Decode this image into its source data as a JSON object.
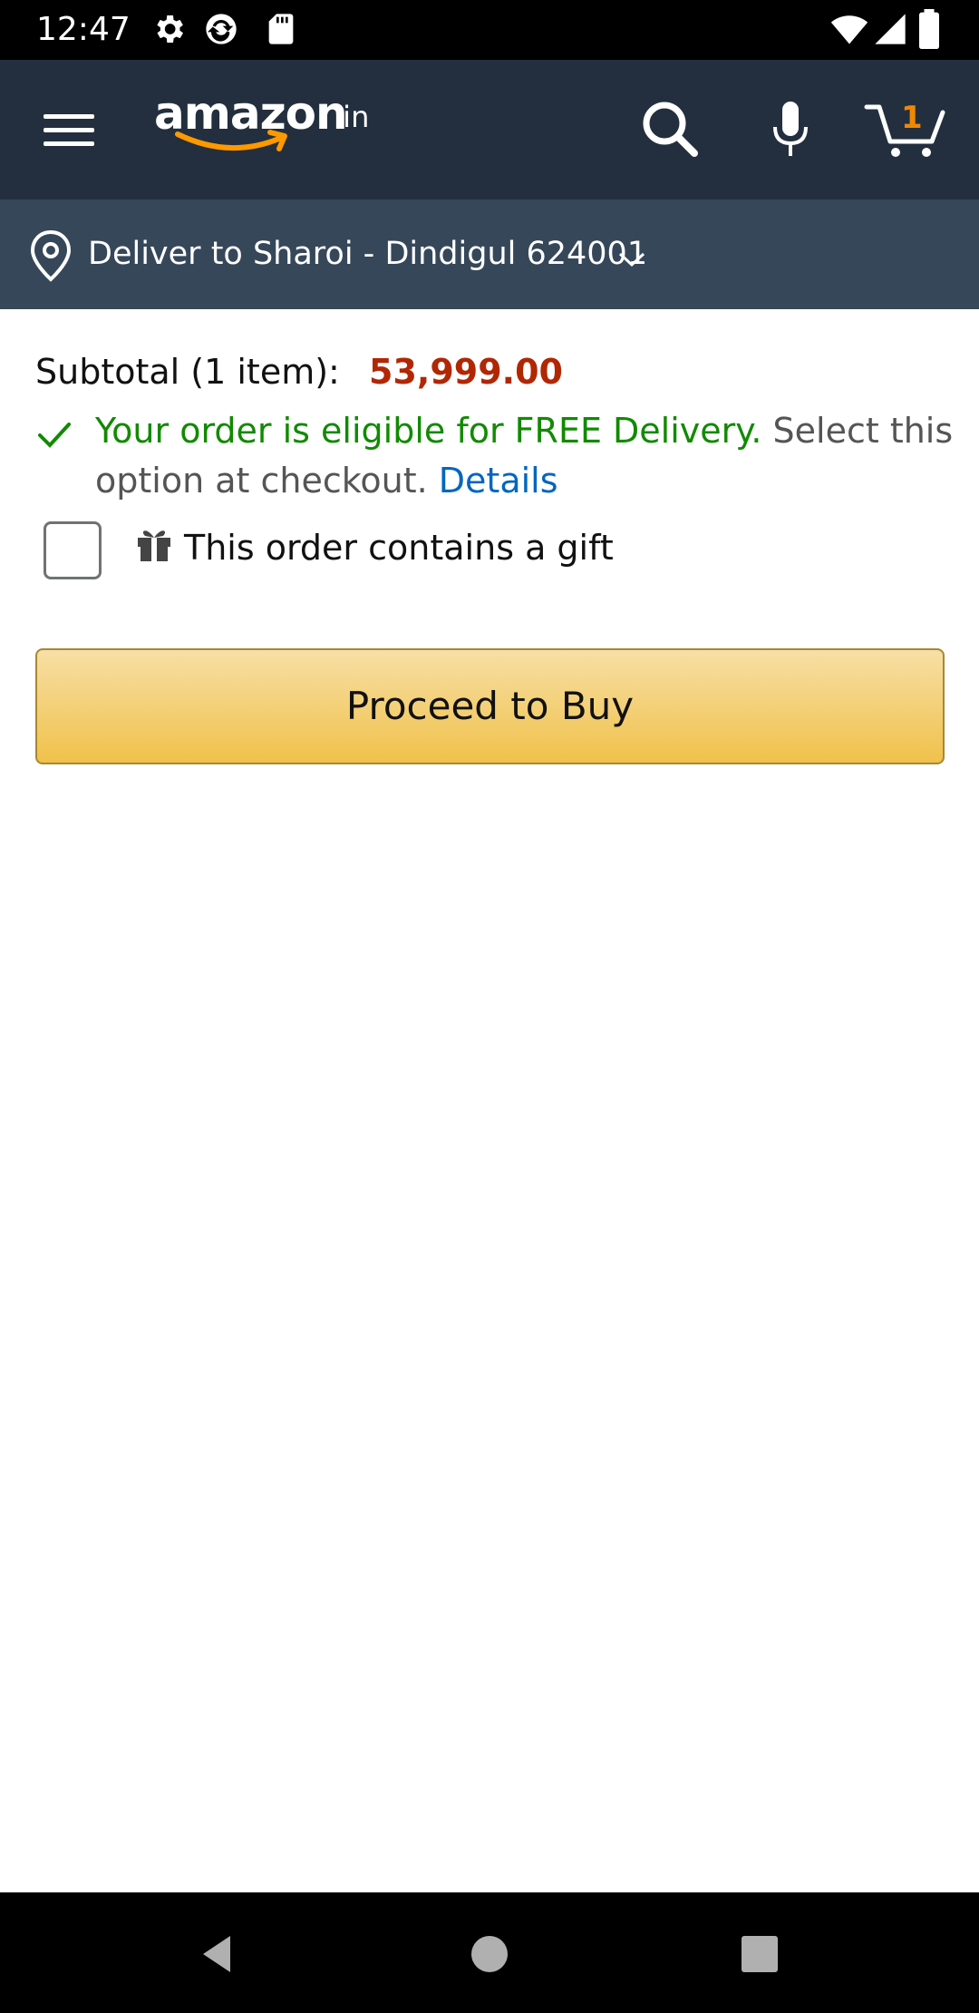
{
  "status_bar": {
    "time": "12:47",
    "left_icons": [
      "gear-icon",
      "sync-icon",
      "sd-card-icon"
    ],
    "right_icons": [
      "wifi-icon",
      "cell-signal-icon",
      "battery-icon"
    ]
  },
  "header": {
    "logo_text": "amazon",
    "logo_suffix": ".in",
    "cart_count": "1",
    "colors": {
      "background": "#232f3e",
      "cart_accent": "#f08804"
    }
  },
  "deliver": {
    "text": "Deliver to Sharoi - Dindigul 624001",
    "background": "#37475a"
  },
  "cart": {
    "subtotal_label": "Subtotal (1 item):",
    "subtotal_value": "53,999.00",
    "free_delivery_green": "Your order is eligible for FREE Delivery.",
    "free_delivery_grey": " Select this option at checkout. ",
    "details_link": "Details",
    "gift_label": "This order contains a gift",
    "gift_checked": false,
    "proceed_button": "Proceed to Buy",
    "colors": {
      "price": "#b12704",
      "success": "#118a00",
      "link": "#0066c0",
      "button": "#f0c14b"
    }
  },
  "nav_bar": {
    "buttons": [
      "back-icon",
      "home-icon",
      "recents-icon"
    ]
  }
}
